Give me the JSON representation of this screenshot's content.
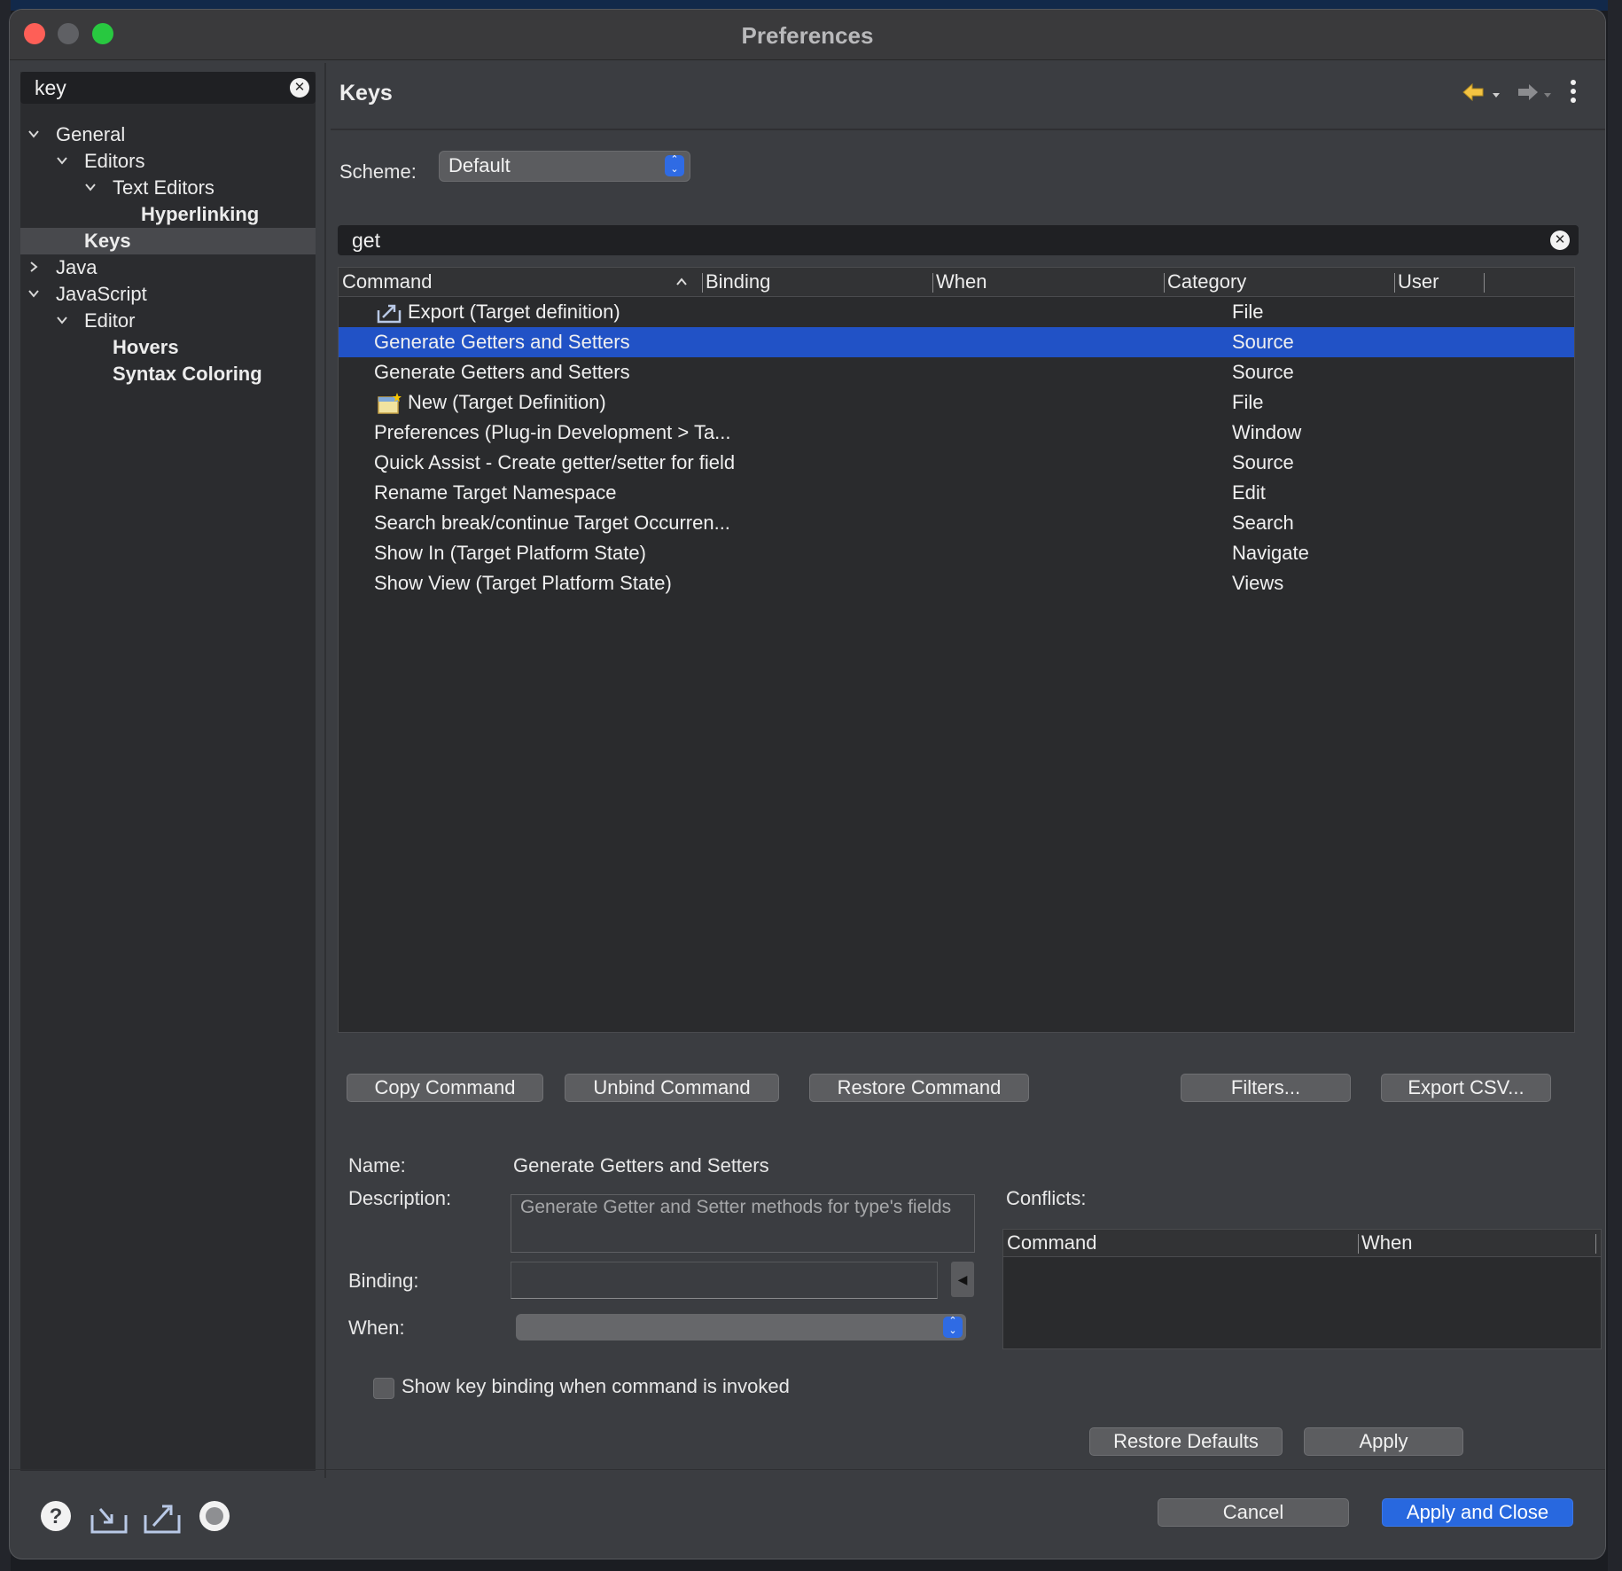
{
  "window": {
    "title": "Preferences"
  },
  "sidebar": {
    "filter_value": "key",
    "tree": [
      {
        "label": "General",
        "expanded": true
      },
      {
        "label": "Editors",
        "expanded": true
      },
      {
        "label": "Text Editors",
        "expanded": true
      },
      {
        "label": "Hyperlinking"
      },
      {
        "label": "Keys",
        "selected": true
      },
      {
        "label": "Java",
        "expanded": false
      },
      {
        "label": "JavaScript",
        "expanded": true
      },
      {
        "label": "Editor",
        "expanded": true
      },
      {
        "label": "Hovers"
      },
      {
        "label": "Syntax Coloring"
      }
    ]
  },
  "main": {
    "title": "Keys",
    "scheme_label": "Scheme:",
    "scheme_value": "Default",
    "filter_value": "get",
    "table": {
      "columns": [
        "Command",
        "Binding",
        "When",
        "Category",
        "User"
      ],
      "rows": [
        {
          "command": "Export (Target definition)",
          "category": "File",
          "icon": "export-icon"
        },
        {
          "command": "Generate Getters and Setters",
          "category": "Source",
          "selected": true
        },
        {
          "command": "Generate Getters and Setters",
          "category": "Source"
        },
        {
          "command": "New (Target Definition)",
          "category": "File",
          "icon": "new-target-icon"
        },
        {
          "command": "Preferences (Plug-in Development > Ta...",
          "category": "Window"
        },
        {
          "command": "Quick Assist - Create getter/setter for field",
          "category": "Source"
        },
        {
          "command": "Rename Target Namespace",
          "category": "Edit"
        },
        {
          "command": "Search break/continue Target Occurren...",
          "category": "Search"
        },
        {
          "command": "Show In (Target Platform State)",
          "category": "Navigate"
        },
        {
          "command": "Show View (Target Platform State)",
          "category": "Views"
        }
      ]
    },
    "buttons": {
      "copy": "Copy Command",
      "unbind": "Unbind Command",
      "restore": "Restore Command",
      "filters": "Filters...",
      "export_csv": "Export CSV..."
    },
    "details": {
      "name_label": "Name:",
      "name_value": "Generate Getters and Setters",
      "description_label": "Description:",
      "description_value": "Generate Getter and Setter methods for type's fields",
      "binding_label": "Binding:",
      "when_label": "When:",
      "conflicts_label": "Conflicts:",
      "conflict_columns": [
        "Command",
        "When"
      ]
    },
    "show_binding_checkbox": {
      "label": "Show key binding when command is invoked",
      "checked": false
    },
    "restore_defaults": "Restore Defaults",
    "apply": "Apply"
  },
  "footer": {
    "cancel": "Cancel",
    "apply_and_close": "Apply and Close",
    "icons": [
      "help-icon",
      "import-icon",
      "export-icon",
      "record-icon"
    ]
  },
  "colors": {
    "selection": "#2152c6",
    "primary_button": "#2868df",
    "close": "#fe5f57",
    "maximize": "#28c840",
    "back_arrow": "#f3c342"
  }
}
